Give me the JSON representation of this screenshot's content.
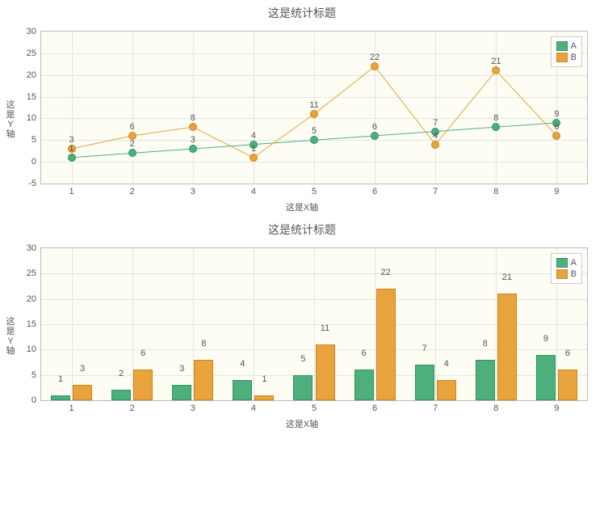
{
  "chart_data": [
    {
      "type": "line",
      "title": "这是统计标题",
      "xlabel": "这是X轴",
      "ylabel": "这是Y轴",
      "ylim": [
        -5,
        30
      ],
      "yticks": [
        -5,
        0,
        5,
        10,
        15,
        20,
        25,
        30
      ],
      "categories": [
        "1",
        "2",
        "3",
        "4",
        "5",
        "6",
        "7",
        "8",
        "9"
      ],
      "series": [
        {
          "name": "A",
          "color": "#4DAF7C",
          "values": [
            1,
            2,
            3,
            4,
            5,
            6,
            7,
            8,
            9
          ]
        },
        {
          "name": "B",
          "color": "#E8A33D",
          "values": [
            3,
            6,
            8,
            1,
            11,
            22,
            4,
            21,
            6
          ]
        }
      ]
    },
    {
      "type": "bar",
      "title": "这是统计标题",
      "xlabel": "这是X轴",
      "ylabel": "这是Y轴",
      "ylim": [
        0,
        30
      ],
      "yticks": [
        0,
        5,
        10,
        15,
        20,
        25,
        30
      ],
      "categories": [
        "1",
        "2",
        "3",
        "4",
        "5",
        "6",
        "7",
        "8",
        "9"
      ],
      "series": [
        {
          "name": "A",
          "color": "#4DAF7C",
          "values": [
            1,
            2,
            3,
            4,
            5,
            6,
            7,
            8,
            9
          ]
        },
        {
          "name": "B",
          "color": "#E8A33D",
          "values": [
            3,
            6,
            8,
            1,
            11,
            22,
            4,
            21,
            6
          ]
        }
      ]
    }
  ]
}
